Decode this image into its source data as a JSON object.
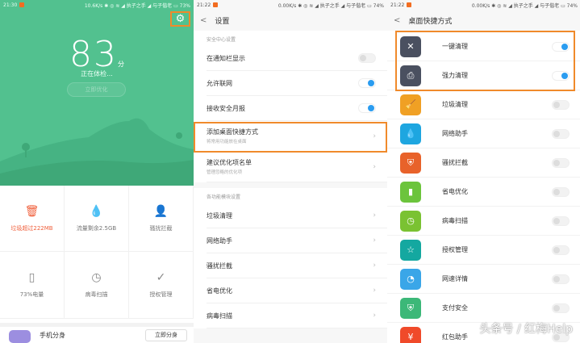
{
  "panel1": {
    "status": {
      "time": "21:30",
      "right": "10.6K/s ✱ ◎ ≋ ◢ 执子之手 ◢ 与子偕老 ▭ 73%"
    },
    "score": "83",
    "score_unit": "分",
    "checking": "正在体检...",
    "optimize_button": "立即优化",
    "grid": [
      {
        "icon": "trash-icon",
        "glyph": "🗑",
        "label": "垃圾超过222MB",
        "warn": true
      },
      {
        "icon": "drop-icon",
        "glyph": "💧",
        "label": "流量剩余2.5GB"
      },
      {
        "icon": "user-block-icon",
        "glyph": "👤",
        "label": "骚扰拦截"
      },
      {
        "icon": "battery-icon",
        "glyph": "▯",
        "label": "73%电量"
      },
      {
        "icon": "virus-scan-icon",
        "glyph": "◷",
        "label": "病毒扫描"
      },
      {
        "icon": "check-circle-icon",
        "glyph": "✓",
        "label": "授权管理"
      }
    ],
    "card": {
      "title": "手机分身",
      "button": "立即分身"
    }
  },
  "panel2": {
    "status": {
      "time": "21:22",
      "right": "0.00K/s ✱ ◎ ≋ ◢ 执子之手 ◢ 与子偕老 ▭ 74%"
    },
    "title": "设置",
    "section1": "安全中心设置",
    "toggles": [
      {
        "label": "在通知栏显示",
        "on": false
      },
      {
        "label": "允许联网",
        "on": true
      },
      {
        "label": "接收安全月报",
        "on": true
      }
    ],
    "links": [
      {
        "label": "添加桌面快捷方式",
        "sub": "将常用功能放在桌面"
      },
      {
        "label": "建议优化项名单",
        "sub": "管理忽略的优化项"
      }
    ],
    "section2": "各功能模块设置",
    "modules": [
      "垃圾清理",
      "网络助手",
      "骚扰拦截",
      "省电优化",
      "病毒扫描"
    ]
  },
  "panel3": {
    "status": {
      "time": "21:22",
      "right": "0.00K/s ✱ ◎ ≋ ◢ 执子之手 ◢ 与子偕老 ▭ 74%"
    },
    "title": "桌面快捷方式",
    "shortcuts": [
      {
        "label": "一键清理",
        "icon": "close-icon",
        "glyph": "✕",
        "color": "#4a5060",
        "on": true
      },
      {
        "label": "强力清理",
        "icon": "printer-clean-icon",
        "glyph": "⎙",
        "color": "#4a5060",
        "on": true
      },
      {
        "label": "垃圾清理",
        "icon": "broom-icon",
        "glyph": "🧹",
        "color": "#f0a024",
        "on": false
      },
      {
        "label": "网络助手",
        "icon": "drop-icon",
        "glyph": "💧",
        "color": "#1ea6e0",
        "on": false
      },
      {
        "label": "骚扰拦截",
        "icon": "shield-user-icon",
        "glyph": "⛨",
        "color": "#e8622a",
        "on": false
      },
      {
        "label": "省电优化",
        "icon": "battery-icon",
        "glyph": "▮",
        "color": "#6cc43c",
        "on": false
      },
      {
        "label": "病毒扫描",
        "icon": "virus-scan-icon",
        "glyph": "◷",
        "color": "#7ac232",
        "on": false
      },
      {
        "label": "授权管理",
        "icon": "star-icon",
        "glyph": "☆",
        "color": "#14a8a0",
        "on": false
      },
      {
        "label": "网速详情",
        "icon": "speedometer-icon",
        "glyph": "◔",
        "color": "#3aa6e8",
        "on": false
      },
      {
        "label": "支付安全",
        "icon": "shield-icon",
        "glyph": "⛨",
        "color": "#3cb878",
        "on": false
      },
      {
        "label": "红包助手",
        "icon": "red-packet-icon",
        "glyph": "¥",
        "color": "#f04a2a",
        "on": false
      }
    ]
  },
  "watermark": "头条号 / 红梅Help"
}
